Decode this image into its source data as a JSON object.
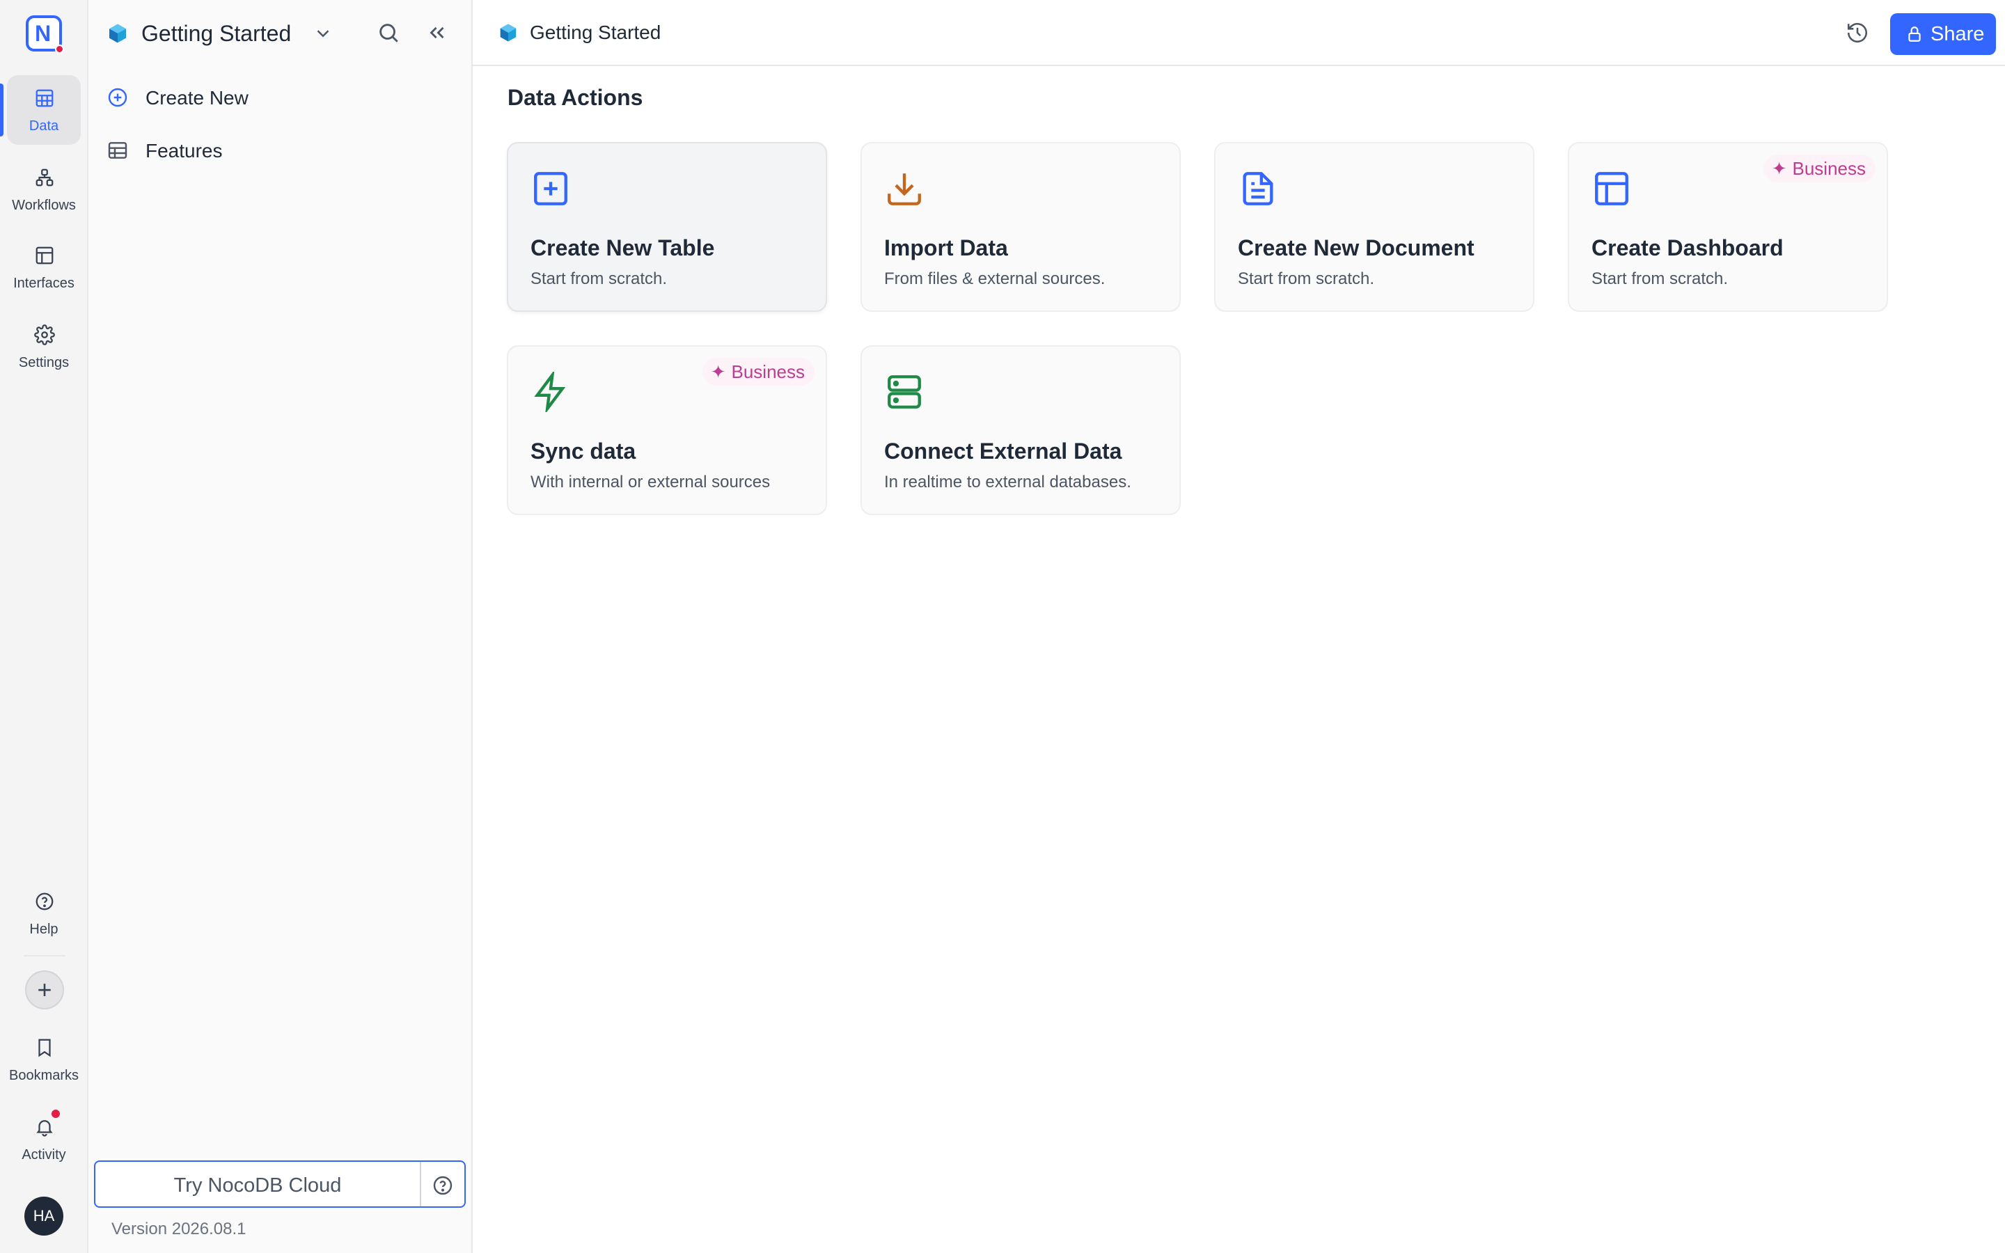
{
  "rail": {
    "items": [
      {
        "label": "Data",
        "icon": "grid-icon"
      },
      {
        "label": "Workflows",
        "icon": "workflow-icon"
      },
      {
        "label": "Interfaces",
        "icon": "layout-icon"
      },
      {
        "label": "Settings",
        "icon": "gear-icon"
      }
    ],
    "bottom": [
      {
        "label": "Help",
        "icon": "help-circle-icon"
      },
      {
        "label": "Bookmarks",
        "icon": "bookmark-icon"
      },
      {
        "label": "Activity",
        "icon": "bell-icon"
      }
    ],
    "logo_letter": "N",
    "avatar_initials": "HA"
  },
  "sidebar": {
    "workspace_title": "Getting Started",
    "items": [
      {
        "label": "Create New",
        "icon": "plus-circle-icon"
      },
      {
        "label": "Features",
        "icon": "table-icon"
      }
    ],
    "try_cloud_label": "Try NocoDB Cloud",
    "version": "Version 2026.08.1"
  },
  "topbar": {
    "title": "Getting Started",
    "share_label": "Share"
  },
  "main": {
    "section_title": "Data Actions",
    "cards": [
      {
        "title": "Create New Table",
        "desc": "Start from scratch.",
        "icon": "plus-square-icon",
        "color": "#3366ff",
        "badge": ""
      },
      {
        "title": "Import Data",
        "desc": "From files & external sources.",
        "icon": "download-icon",
        "color": "#c2671f",
        "badge": ""
      },
      {
        "title": "Create New Document",
        "desc": "Start from scratch.",
        "icon": "document-icon",
        "color": "#3366ff",
        "badge": ""
      },
      {
        "title": "Create Dashboard",
        "desc": "Start from scratch.",
        "icon": "dashboard-icon",
        "color": "#3366ff",
        "badge": "Business"
      },
      {
        "title": "Sync data",
        "desc": "With internal or external sources",
        "icon": "lightning-icon",
        "color": "#1f8a47",
        "badge": "Business"
      },
      {
        "title": "Connect External Data",
        "desc": "In realtime to external databases.",
        "icon": "server-icon",
        "color": "#1f8a47",
        "badge": ""
      }
    ]
  },
  "colors": {
    "accent": "#3366ff",
    "badge_text": "#be3d8f",
    "badge_bg": "#fdf2f8",
    "notification": "#e11d48"
  }
}
